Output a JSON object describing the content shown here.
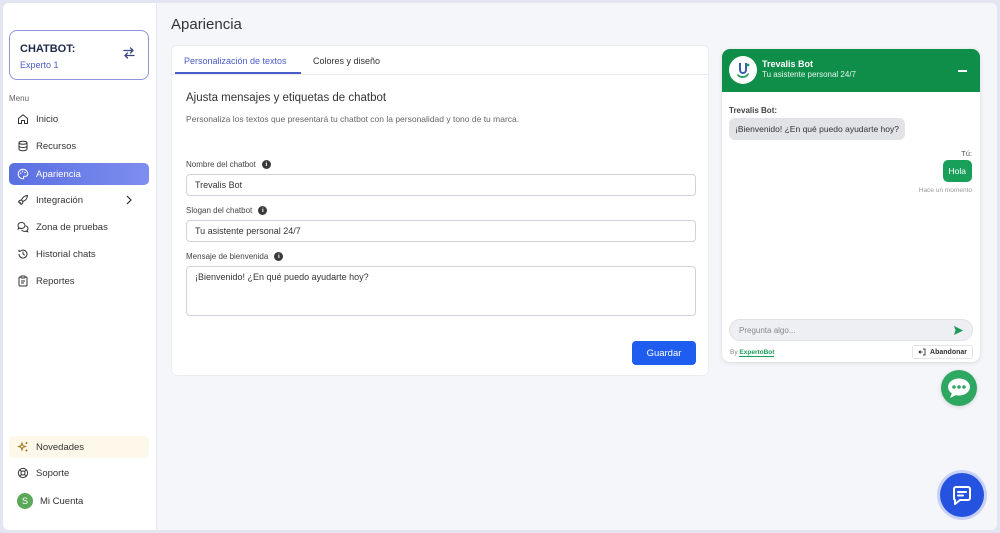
{
  "sidebar": {
    "bot_title": "CHATBOT:",
    "bot_plan": "Experto 1",
    "menu_label": "Menu",
    "items": [
      {
        "label": "Inicio",
        "icon": "home-icon"
      },
      {
        "label": "Recursos",
        "icon": "database-icon"
      },
      {
        "label": "Apariencia",
        "icon": "palette-icon",
        "active": true
      },
      {
        "label": "Integración",
        "icon": "rocket-icon"
      },
      {
        "label": "Zona de pruebas",
        "icon": "chat-bubbles-icon"
      },
      {
        "label": "Historial chats",
        "icon": "history-icon"
      },
      {
        "label": "Reportes",
        "icon": "clipboard-icon"
      }
    ],
    "bottom": {
      "news": "Novedades",
      "support": "Soporte",
      "account": "Mi Cuenta",
      "avatar_initial": "S"
    }
  },
  "main": {
    "page_title": "Apariencia",
    "tabs": [
      {
        "label": "Personalización de textos",
        "active": true
      },
      {
        "label": "Colores y diseño"
      }
    ],
    "section_title": "Ajusta mensajes y etiquetas de chatbot",
    "section_desc": "Personaliza los textos que presentará tu chatbot con la personalidad y tono de tu marca.",
    "fields": {
      "name_label": "Nombre del chatbot",
      "name_value": "Trevalis Bot",
      "slogan_label": "Slogan del chatbot",
      "slogan_value": "Tu asistente personal 24/7",
      "welcome_label": "Mensaje de bienvenida",
      "welcome_value": "¡Bienvenido! ¿En qué puedo ayudarte hoy?"
    },
    "save_label": "Guardar"
  },
  "chat_preview": {
    "bot_name": "Trevalis Bot",
    "bot_slogan": "Tu asistente personal 24/7",
    "bot_label": "Trevalis Bot:",
    "bot_message": "¡Bienvenido! ¿En qué puedo ayudarte hoy?",
    "user_label": "Tú:",
    "user_message": "Hola",
    "timestamp": "Hace un momento",
    "input_placeholder": "Pregunta algo...",
    "by": "By",
    "brand": "ExpertoBot",
    "leave_label": "Abandonar"
  },
  "colors": {
    "accent": "#4a5cc8",
    "primary_button": "#1f5cf0",
    "chat_green": "#0f8e4a"
  }
}
